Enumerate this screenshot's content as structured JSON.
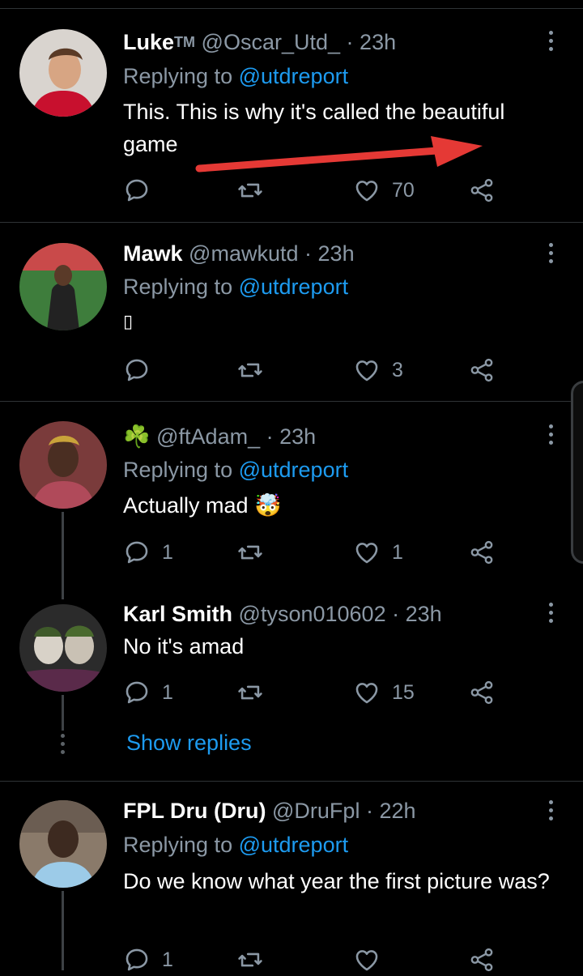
{
  "tweets": [
    {
      "name": "Luke",
      "badge": "TM",
      "handle": "@Oscar_Utd_",
      "time": "23h",
      "reply_prefix": "Replying to",
      "reply_mention": "@utdreport",
      "text": "This. This is why it's called the beautiful game",
      "counts": {
        "reply": "",
        "retweet": "",
        "like": "70"
      },
      "avatar": "avatar-red-shirt-player"
    },
    {
      "name": "Mawk",
      "handle": "@mawkutd",
      "time": "23h",
      "reply_prefix": "Replying to",
      "reply_mention": "@utdreport",
      "text": "▯",
      "counts": {
        "reply": "",
        "retweet": "",
        "like": "3"
      },
      "avatar": "avatar-green-pitch-player"
    },
    {
      "name": "☘️",
      "handle": "@ftAdam_",
      "time": "23h",
      "reply_prefix": "Replying to",
      "reply_mention": "@utdreport",
      "text": "Actually mad",
      "emoji": "🤯",
      "counts": {
        "reply": "1",
        "retweet": "",
        "like": "1"
      },
      "avatar": "avatar-player-portrait"
    },
    {
      "name": "Karl Smith",
      "handle": "@tyson010602",
      "time": "23h",
      "text": "No it's amad",
      "counts": {
        "reply": "1",
        "retweet": "",
        "like": "15"
      },
      "avatar": "avatar-joker"
    },
    {
      "name": "FPL Dru (Dru)",
      "handle": "@DruFpl",
      "time": "22h",
      "reply_prefix": "Replying to",
      "reply_mention": "@utdreport",
      "text": "Do we know what year the first picture was?",
      "counts": {
        "reply": "1",
        "retweet": "",
        "like": ""
      },
      "avatar": "avatar-sky-blue-kit"
    }
  ],
  "show_replies": "Show replies",
  "separator": "·",
  "icons": {
    "reply": "reply-icon",
    "retweet": "retweet-icon",
    "like": "heart-icon",
    "share": "share-icon",
    "more": "more-options-icon"
  },
  "colors": {
    "background": "#000000",
    "accent": "#1d9bf0",
    "muted": "#8b98a5",
    "annotation_arrow": "#e53935"
  }
}
